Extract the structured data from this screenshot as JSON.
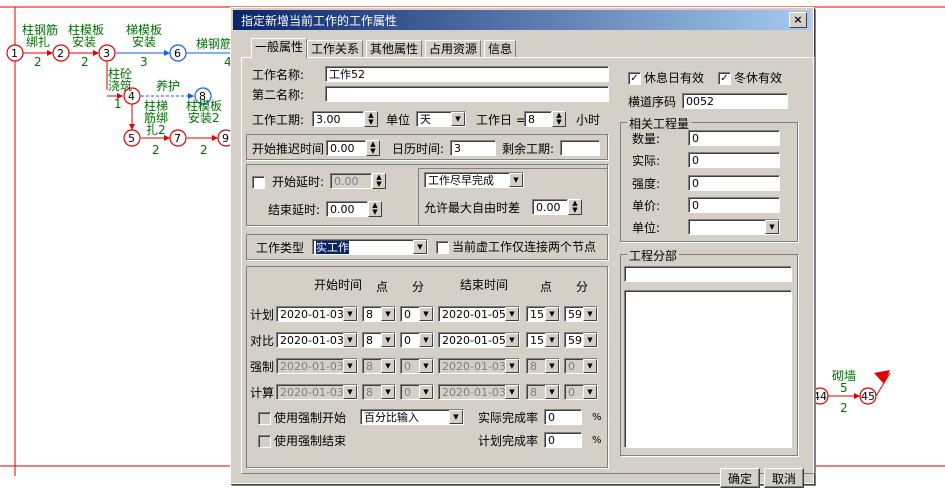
{
  "network": {
    "nodes": [
      "1",
      "2",
      "3",
      "4",
      "5",
      "6",
      "7",
      "8",
      "9",
      "44",
      "45"
    ],
    "task_labels": {
      "t1": "柱钢筋",
      "t1b": "绑扎",
      "t1d": "2",
      "t2": "柱模板",
      "t2b": "安装",
      "t2d": "2",
      "t3": "梯模板",
      "t3b": "安装",
      "t3d": "3",
      "t4": "梯钢筋",
      "t4d": "4",
      "t5": "柱砼",
      "t5b": "浇筑",
      "t5d": "1",
      "t6": "养护",
      "t7": "柱梯",
      "t7b": "筋绑",
      "t7c": "扎2",
      "t7d": "2",
      "t8": "柱模板",
      "t8b": "安装2",
      "t8d": "2",
      "t9": "砌墙",
      "t9d": "5",
      "t9e": "2"
    }
  },
  "dialog": {
    "title": "指定新增当前工作的工作属性",
    "close_label": "×",
    "tabs": [
      "一般属性",
      "工作关系",
      "其他属性",
      "占用资源",
      "信息"
    ],
    "name_label": "工作名称:",
    "name_value": "工作52",
    "second_name_label": "第二名称:",
    "second_name_value": "",
    "duration_label": "工作工期:",
    "duration_value": "3.00",
    "unit_label": "单位",
    "unit_value": "天",
    "workday_label": "工作日 =",
    "workday_value": "8",
    "hours_label": "小时",
    "start_delay_time_label": "开始推迟时间",
    "start_delay_time_value": "0.00",
    "calendar_time_label": "日历时间:",
    "calendar_time_value": "3",
    "remaining_label": "剩余工期:",
    "remaining_value": "",
    "start_lag_label": "开始延时:",
    "start_lag_value": "0.00",
    "end_lag_label": "结束延时:",
    "end_lag_value": "0.00",
    "schedule_mode_value": "工作尽早完成",
    "max_free_float_label": "允许最大自由时差",
    "max_free_float_value": "0.00",
    "task_type_label": "工作类型",
    "task_type_value": "实工作",
    "virtual_only_label": "当前虚工作仅连接两个节点",
    "time_headers": {
      "start": "开始时间",
      "hour": "点",
      "minute": "分",
      "end": "结束时间",
      "hour2": "点",
      "minute2": "分"
    },
    "time_rows": [
      {
        "label": "计划",
        "start": "2020-01-03",
        "sh": "8",
        "sm": "0",
        "end": "2020-01-05",
        "eh": "15",
        "em": "59",
        "enabled": true
      },
      {
        "label": "对比",
        "start": "2020-01-03",
        "sh": "8",
        "sm": "0",
        "end": "2020-01-05",
        "eh": "15",
        "em": "59",
        "enabled": true
      },
      {
        "label": "强制",
        "start": "2020-01-03",
        "sh": "8",
        "sm": "0",
        "end": "2020-01-03",
        "eh": "8",
        "em": "0",
        "enabled": false
      },
      {
        "label": "计算",
        "start": "2020-01-03",
        "sh": "8",
        "sm": "0",
        "end": "2020-01-03",
        "eh": "8",
        "em": "0",
        "enabled": false
      }
    ],
    "force_start_label": "使用强制开始",
    "force_end_label": "使用强制结束",
    "percent_mode_value": "百分比输入",
    "actual_rate_label": "实际完成率",
    "actual_rate_value": "0",
    "plan_rate_label": "计划完成率",
    "plan_rate_value": "0",
    "percent_sign": "%",
    "holiday_label": "休息日有效",
    "winter_label": "冬休有效",
    "lane_label": "横道序码",
    "lane_value": "0052",
    "quantities_title": "相关工程量",
    "quantity_label": "数量:",
    "quantity_value": "0",
    "actual_label": "实际:",
    "actual_value": "0",
    "intensity_label": "强度:",
    "intensity_value": "0",
    "price_label": "单价:",
    "price_value": "0",
    "qunit_label": "单位:",
    "qunit_value": "",
    "section_title": "工程分部",
    "section_value": "",
    "ok_label": "确定",
    "cancel_label": "取消"
  },
  "colors": {
    "node_red": "#e00000",
    "node_blue": "#1060e0",
    "text_green": "#007000",
    "title_bar": "#0a246a"
  }
}
